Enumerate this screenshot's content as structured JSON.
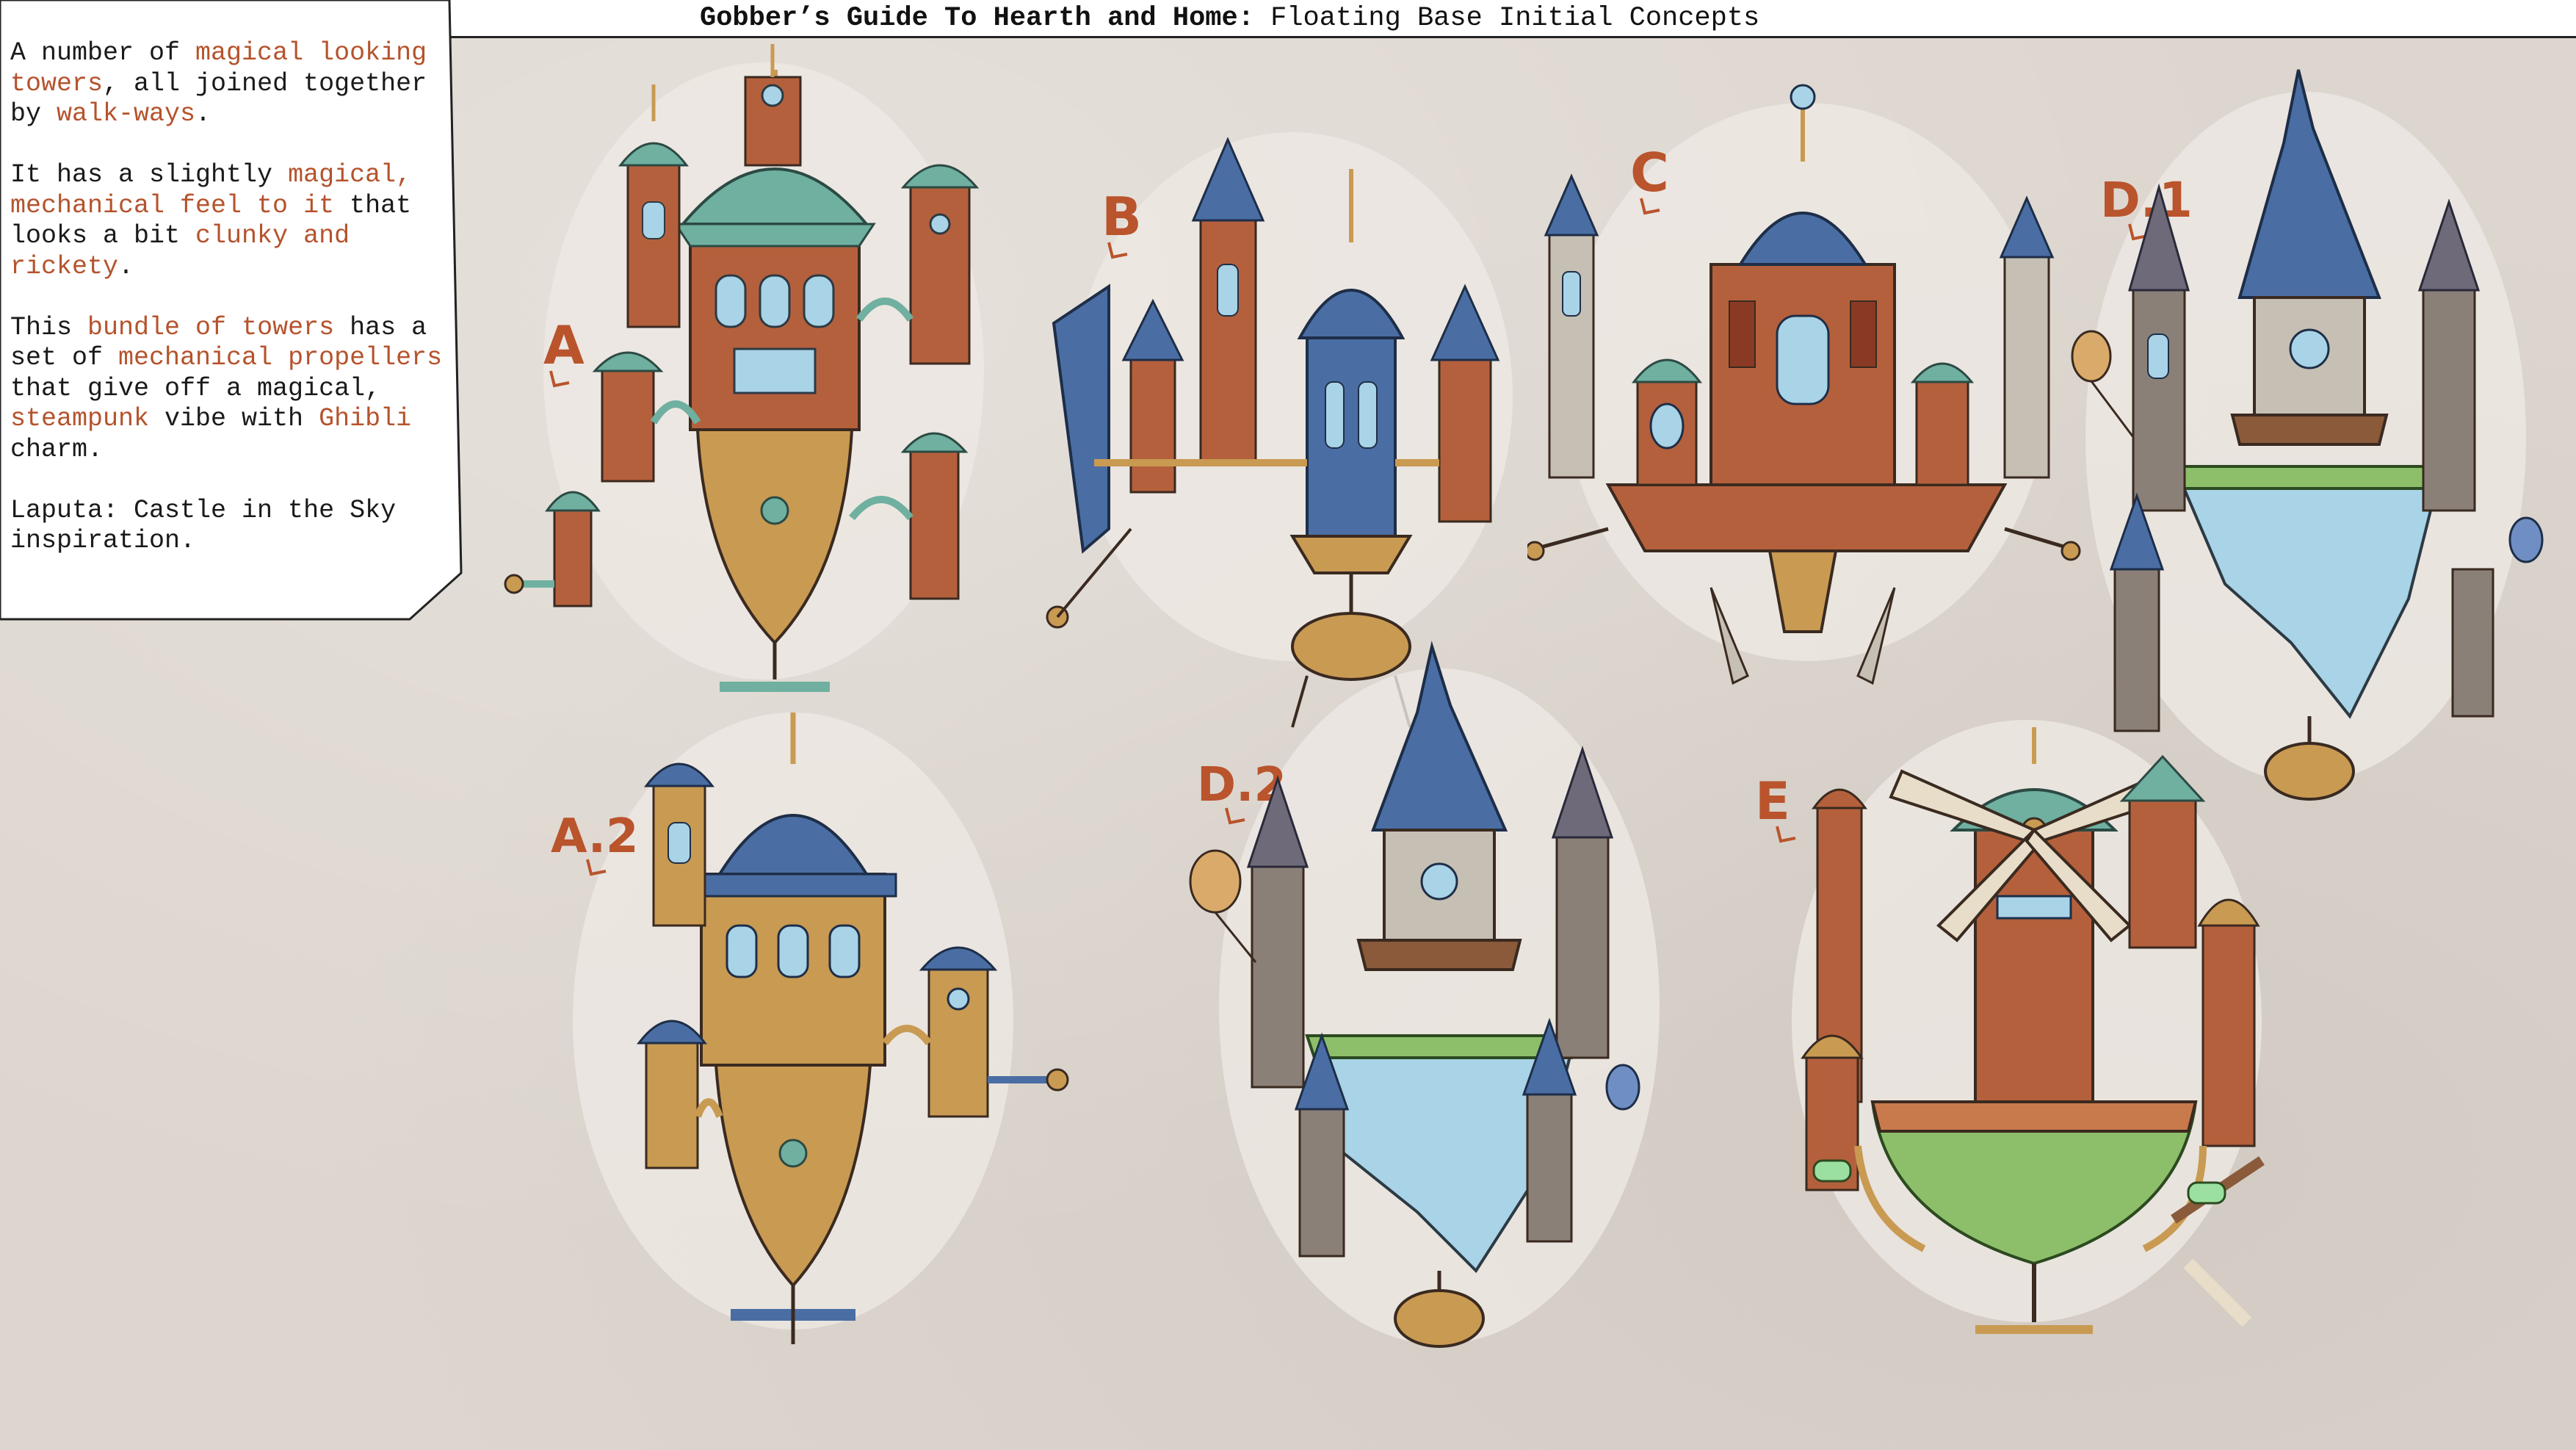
{
  "header": {
    "title_bold": "Gobber’s Guide To Hearth and Home:",
    "title_rest": " Floating Base Initial Concepts"
  },
  "notes": {
    "p1": {
      "t1": "A number of ",
      "h1": "magical looking towers",
      "t2": ", all joined together by ",
      "h2": "walk-ways",
      "t3": "."
    },
    "p2": {
      "t1": "It has a slightly ",
      "h1": "magical, mechanical feel to it",
      "t2": " that looks a bit ",
      "h2": "clunky and rickety",
      "t3": "."
    },
    "p3": {
      "t1": "This ",
      "h1": "bundle of towers",
      "t2": " has a set of ",
      "h2": "mechanical propellers",
      "t3": " that give off a magical, ",
      "h3": "steampunk",
      "t4": " vibe with ",
      "h4": "Ghibli",
      "t5": " charm."
    },
    "p4": "Laputa: Castle in the Sky inspiration."
  },
  "concepts": [
    {
      "label": "A"
    },
    {
      "label": "B"
    },
    {
      "label": "C"
    },
    {
      "label": "D.1"
    },
    {
      "label": "A.2"
    },
    {
      "label": "D.2"
    },
    {
      "label": "E"
    }
  ],
  "colors": {
    "accent": "#b5532c",
    "paper": "#ddd6cf",
    "brick": "#b5603c",
    "teal": "#6fb0a0",
    "blue": "#4a6ea3",
    "brass": "#c99a52",
    "stone": "#8a8077",
    "water": "#a9d3e6",
    "grass": "#8dbf6a"
  }
}
